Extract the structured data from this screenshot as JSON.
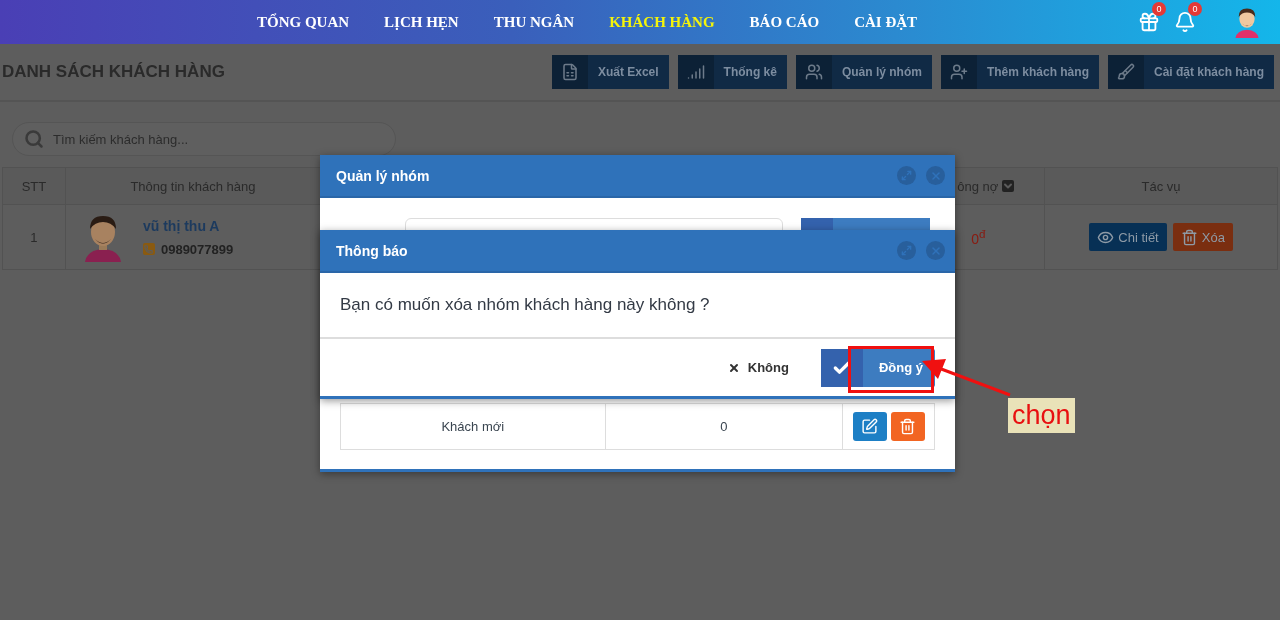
{
  "nav": {
    "items": [
      {
        "label": "TỔNG QUAN",
        "selected": false
      },
      {
        "label": "LỊCH HẸN",
        "selected": false
      },
      {
        "label": "THU NGÂN",
        "selected": false
      },
      {
        "label": "KHÁCH HÀNG",
        "selected": true
      },
      {
        "label": "BÁO CÁO",
        "selected": false
      },
      {
        "label": "CÀI ĐẶT",
        "selected": false
      }
    ],
    "gift_badge": "0",
    "bell_badge": "0"
  },
  "page": {
    "title": "DANH SÁCH KHÁCH HÀNG",
    "toolbar": [
      {
        "label": "Xuất Excel",
        "kind": "excel"
      },
      {
        "label": "Thống kê",
        "kind": "stats"
      },
      {
        "label": "Quản lý nhóm",
        "kind": "group"
      },
      {
        "label": "Thêm khách hàng",
        "kind": "add"
      },
      {
        "label": "Cài đặt khách hàng",
        "kind": "settings"
      }
    ],
    "search": {
      "placeholder": "Tìm kiếm khách hàng..."
    },
    "table": {
      "columns": [
        {
          "label": "STT",
          "dropdown": false
        },
        {
          "label": "Thông tin khách hàng",
          "dropdown": false
        },
        {
          "label": "ông nợ",
          "dropdown": true
        },
        {
          "label": "Tác vụ",
          "dropdown": false
        }
      ],
      "rows": [
        {
          "stt": "1",
          "name": "vũ thị thu A",
          "phone": "0989077899",
          "debt": "0$^{đ}$",
          "actions": [
            {
              "label": "Chi tiết",
              "kind": "view"
            },
            {
              "label": "Xóa",
              "kind": "delete"
            }
          ]
        }
      ]
    }
  },
  "group_dialog": {
    "title": "Quản lý nhóm",
    "rows": [
      {
        "name": "Khách mới",
        "count": "0"
      }
    ]
  },
  "confirm_dialog": {
    "title": "Thông báo",
    "message": "Bạn có muốn xóa nhóm khách hàng này không ?",
    "buttons": [
      {
        "label": "Không",
        "kind": "cancel"
      },
      {
        "label": "Đồng ý",
        "kind": "confirm"
      }
    ]
  },
  "annotation": {
    "label": "chọn"
  }
}
